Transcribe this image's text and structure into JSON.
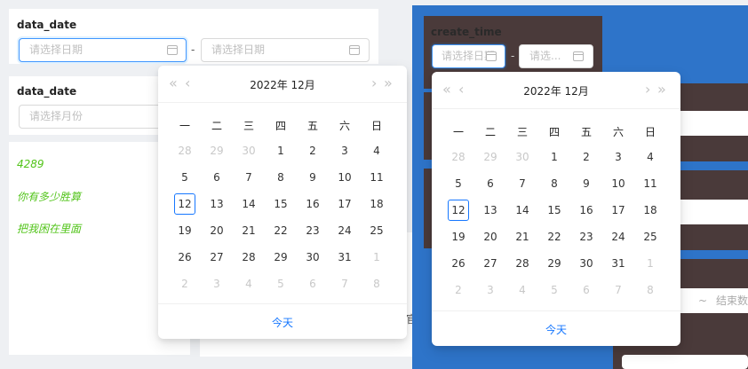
{
  "left_form": {
    "field1_label": "data_date",
    "start_placeholder": "请选择日期",
    "end_placeholder": "请选择日期",
    "separator": "-",
    "field2_label": "data_date",
    "month_placeholder": "请选择月份"
  },
  "green_texts": [
    "4289",
    "你有多少胜算",
    "把我困在里面"
  ],
  "right_form": {
    "field_label": "create_time",
    "start_placeholder": "请选择日期",
    "end_placeholder": "请选...",
    "separator": "-",
    "range_sep": "~",
    "end_label": "结束数",
    "partial_char": "官"
  },
  "calendar": {
    "title": "2022年  12月",
    "weekdays": [
      "一",
      "二",
      "三",
      "四",
      "五",
      "六",
      "日"
    ],
    "days": [
      [
        28,
        29,
        30,
        1,
        2,
        3,
        4
      ],
      [
        5,
        6,
        7,
        8,
        9,
        10,
        11
      ],
      [
        12,
        13,
        14,
        15,
        16,
        17,
        18
      ],
      [
        19,
        20,
        21,
        22,
        23,
        24,
        25
      ],
      [
        26,
        27,
        28,
        29,
        30,
        31,
        1
      ],
      [
        2,
        3,
        4,
        5,
        6,
        7,
        8
      ]
    ],
    "today_label": "今天",
    "today_value": 12
  },
  "colors": {
    "accent": "#1677ff",
    "green": "#52c41a",
    "blue_bg": "#2e74c9",
    "brown": "#4a3a3a"
  }
}
